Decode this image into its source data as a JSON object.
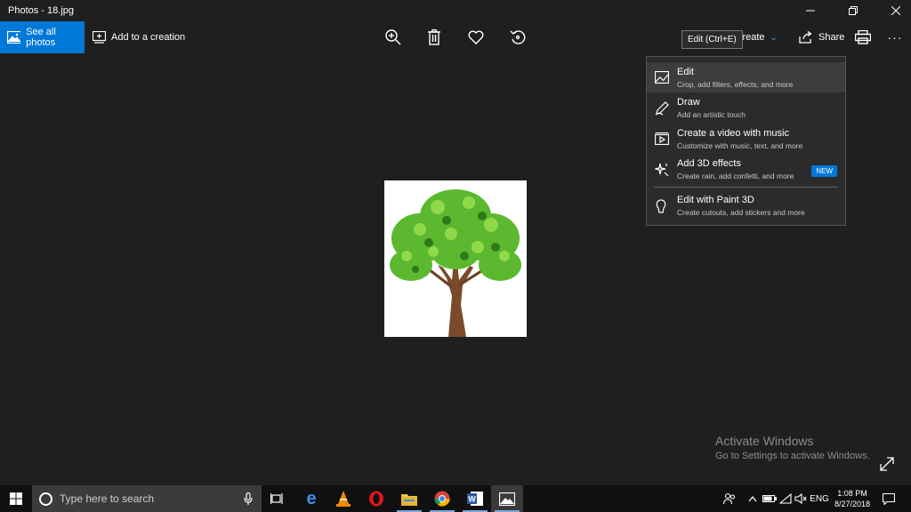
{
  "window": {
    "title": "Photos - 18.jpg"
  },
  "toolbar": {
    "see_all_photos": "See all photos",
    "add_to_creation": "Add to a creation",
    "edit_create_partial": "t & Create",
    "share": "Share",
    "more": "···"
  },
  "tooltip": {
    "text": "Edit (Ctrl+E)"
  },
  "menu": {
    "items": [
      {
        "title": "Edit",
        "subtitle": "Crop, add filters, effects, and more",
        "icon": "photo-edit-icon"
      },
      {
        "title": "Draw",
        "subtitle": "Add an artistic touch",
        "icon": "pen-icon"
      },
      {
        "title": "Create a video with music",
        "subtitle": "Customize with music, text, and more",
        "icon": "video-icon"
      },
      {
        "title": "Add 3D effects",
        "subtitle": "Create rain, add confetti, and more",
        "icon": "sparkle-icon",
        "badge": "NEW"
      },
      {
        "title": "Edit with Paint 3D",
        "subtitle": "Create cutouts, add stickers and more",
        "icon": "paint3d-icon"
      }
    ]
  },
  "watermark": {
    "line1": "Activate Windows",
    "line2": "Go to Settings to activate Windows."
  },
  "taskbar": {
    "search_placeholder": "Type here to search",
    "language": "ENG",
    "time": "1:08 PM",
    "date": "8/27/2018"
  },
  "colors": {
    "accent": "#0078d7",
    "background": "#1f1f1f",
    "taskbar": "#101010"
  }
}
